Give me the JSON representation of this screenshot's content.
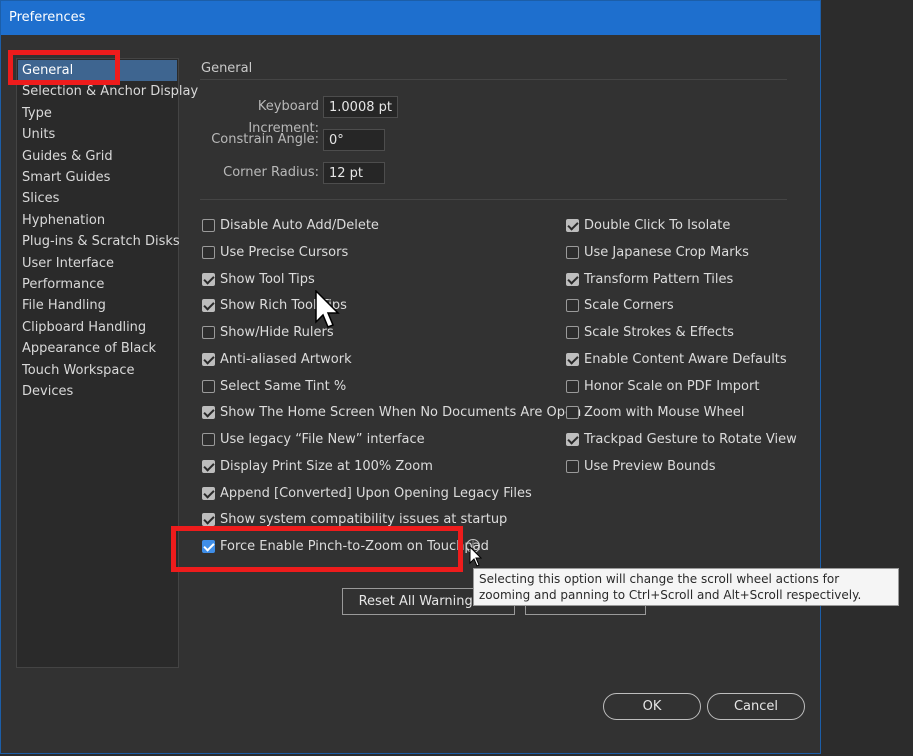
{
  "window": {
    "title": "Preferences"
  },
  "sidebar": {
    "items": [
      {
        "label": "General",
        "selected": true
      },
      {
        "label": "Selection & Anchor Display"
      },
      {
        "label": "Type"
      },
      {
        "label": "Units"
      },
      {
        "label": "Guides & Grid"
      },
      {
        "label": "Smart Guides"
      },
      {
        "label": "Slices"
      },
      {
        "label": "Hyphenation"
      },
      {
        "label": "Plug-ins & Scratch Disks"
      },
      {
        "label": "User Interface"
      },
      {
        "label": "Performance"
      },
      {
        "label": "File Handling"
      },
      {
        "label": "Clipboard Handling"
      },
      {
        "label": "Appearance of Black"
      },
      {
        "label": "Touch Workspace"
      },
      {
        "label": "Devices"
      }
    ]
  },
  "general": {
    "section_title": "General",
    "keyboard_increment": {
      "label": "Keyboard Increment:",
      "value": "1.0008 pt"
    },
    "constrain_angle": {
      "label": "Constrain Angle:",
      "value": "0°"
    },
    "corner_radius": {
      "label": "Corner Radius:",
      "value": "12 pt"
    }
  },
  "options_left": [
    {
      "label": "Disable Auto Add/Delete",
      "checked": false
    },
    {
      "label": "Use Precise Cursors",
      "checked": false
    },
    {
      "label": "Show Tool Tips",
      "checked": true
    },
    {
      "label": "Show Rich Tool Tips",
      "checked": true
    },
    {
      "label": "Show/Hide Rulers",
      "checked": false
    },
    {
      "label": "Anti-aliased Artwork",
      "checked": true
    },
    {
      "label": "Select Same Tint %",
      "checked": false
    },
    {
      "label": "Show The Home Screen When No Documents Are Open",
      "checked": true
    },
    {
      "label": "Use legacy “File New” interface",
      "checked": false
    },
    {
      "label": "Display Print Size at 100% Zoom",
      "checked": true
    },
    {
      "label": "Append [Converted] Upon Opening Legacy Files",
      "checked": true
    },
    {
      "label": "Show system compatibility issues at startup",
      "checked": true
    },
    {
      "label": "Force Enable Pinch-to-Zoom on Touchpad",
      "checked": true
    }
  ],
  "options_right": [
    {
      "label": "Double Click To Isolate",
      "checked": true
    },
    {
      "label": "Use Japanese Crop Marks",
      "checked": false
    },
    {
      "label": "Transform Pattern Tiles",
      "checked": true
    },
    {
      "label": "Scale Corners",
      "checked": false
    },
    {
      "label": "Scale Strokes & Effects",
      "checked": false
    },
    {
      "label": "Enable Content Aware Defaults",
      "checked": true
    },
    {
      "label": "Honor Scale on PDF Import",
      "checked": false
    },
    {
      "label": "Zoom with Mouse Wheel",
      "checked": false
    },
    {
      "label": "Trackpad Gesture to Rotate View",
      "checked": true
    },
    {
      "label": "Use Preview Bounds",
      "checked": false
    }
  ],
  "info_icon": {
    "icon": "info-icon",
    "glyph": "i"
  },
  "tooltip": {
    "text": "Selecting this option will change the scroll wheel actions for zooming and panning to Ctrl+Scroll and Alt+Scroll respectively."
  },
  "buttons": {
    "reset": "Reset All Warning Dia",
    "ok": "OK",
    "cancel": "Cancel"
  },
  "colors": {
    "title_bar": "#1e6fce",
    "selection": "#3e6590",
    "highlight": "#ee1c1c",
    "checkbox_accent": "#3f8ee8"
  }
}
